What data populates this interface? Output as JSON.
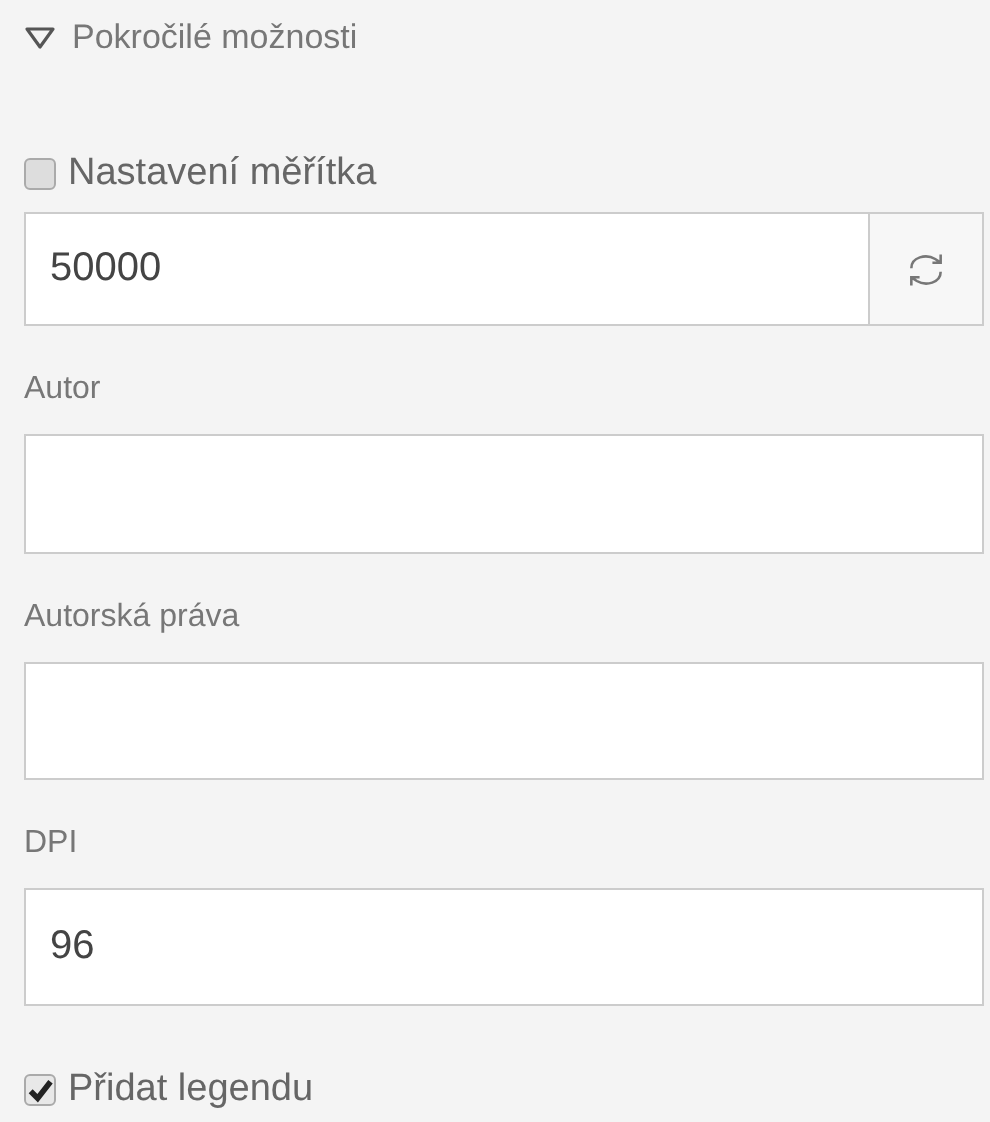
{
  "section": {
    "title": "Pokročilé možnosti",
    "expanded": true
  },
  "scale_option": {
    "label": "Nastavení měřítka",
    "checked": false
  },
  "scale_field": {
    "value": "50000"
  },
  "fields": [
    {
      "label": "Autor"
    },
    {
      "label": "Autorská práva"
    },
    {
      "label": "DPI",
      "value": "96"
    }
  ],
  "legend_option": {
    "label": "Přidat legendu",
    "checked": true
  }
}
